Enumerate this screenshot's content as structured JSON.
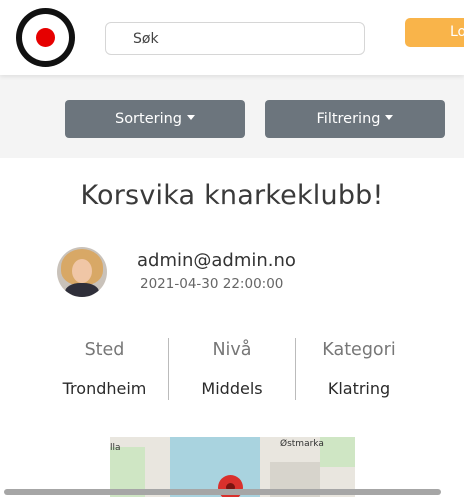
{
  "header": {
    "logo_icon": "target-logo-icon",
    "search_placeholder": "Søk",
    "login_label": "Logg inn",
    "login_color": "#f9b44a"
  },
  "toolbar": {
    "sort_label": "Sortering",
    "filter_label": "Filtrering",
    "button_color": "#6c757d"
  },
  "post": {
    "title": "Korsvika knarkeklubb!",
    "author_email": "admin@admin.no",
    "date": "2021-04-30 22:00:00"
  },
  "info": [
    {
      "label": "Sted",
      "value": "Trondheim"
    },
    {
      "label": "Nivå",
      "value": "Middels"
    },
    {
      "label": "Kategori",
      "value": "Klatring"
    }
  ],
  "map": {
    "labels": [
      "lla",
      "Østmarka"
    ],
    "marker_color": "#d9302c"
  }
}
